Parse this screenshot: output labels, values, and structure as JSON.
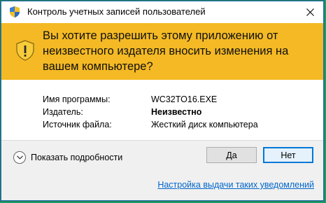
{
  "window": {
    "title": "Контроль учетных записей пользователей",
    "close_glyph": "✕",
    "title_icon": "uac-shield-icon"
  },
  "banner": {
    "color": "#f4b924",
    "icon": "warning-shield-icon",
    "question": "Вы хотите разрешить этому приложению от неизвестного издателя вносить изменения на вашем компьютере?"
  },
  "info": {
    "program_label": "Имя программы:",
    "program_value": "WC32TO16.EXE",
    "publisher_label": "Издатель:",
    "publisher_value": "Неизвестно",
    "source_label": "Источник файла:",
    "source_value": "Жесткий диск компьютера"
  },
  "footer": {
    "details_label": "Показать подробности",
    "yes_label": "Да",
    "no_label": "Нет",
    "settings_link": "Настройка выдачи таких уведомлений"
  },
  "colors": {
    "desktop": "#1e9c69",
    "accent": "#0078d7",
    "link": "#0066cc"
  }
}
